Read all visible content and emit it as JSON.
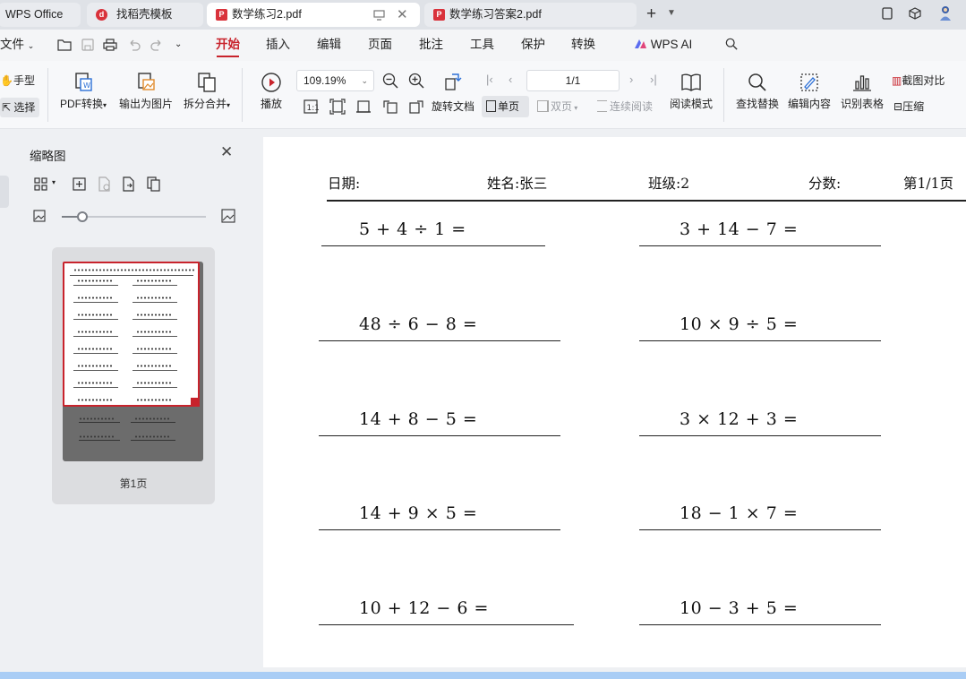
{
  "tabs": [
    {
      "label": "WPS Office",
      "active": false
    },
    {
      "label": "找稻壳模板",
      "active": false
    },
    {
      "label": "数学练习2.pdf",
      "active": true
    },
    {
      "label": "数学练习答案2.pdf",
      "active": false
    }
  ],
  "menu": {
    "file_label": "文件",
    "items": [
      "开始",
      "插入",
      "编辑",
      "页面",
      "批注",
      "工具",
      "保护",
      "转换"
    ],
    "active": "开始",
    "ai_label": "WPS AI"
  },
  "ribbon": {
    "hand_label": "手型",
    "select_label": "选择",
    "pdf_convert": "PDF转换",
    "export_image": "输出为图片",
    "split_merge": "拆分合并",
    "play": "播放",
    "zoom": "109.19%",
    "page_indicator": "1/1",
    "rotate": "旋转文档",
    "single_page": "单页",
    "double_page": "双页",
    "continuous": "连续阅读",
    "read_mode": "阅读模式",
    "find_replace": "查找替换",
    "edit_content": "编辑内容",
    "recognize_table": "识别表格",
    "screenshot_compare": "截图对比",
    "compress": "压缩"
  },
  "thumbnail_panel": {
    "title": "缩略图",
    "zoom_level": 0.14,
    "page_label": "第1页"
  },
  "document": {
    "header": {
      "date_label": "日期:",
      "name_label": "姓名:张三",
      "class_label": "班级:2",
      "score_label": "分数:",
      "page_label": "第1/1页"
    },
    "equations": [
      {
        "left": "5 + 4 ÷ 1 =",
        "right": "3 + 14 − 7 ="
      },
      {
        "left": "48 ÷ 6 − 8 =",
        "right": "10 × 9 ÷ 5 ="
      },
      {
        "left": "14 + 8 − 5 =",
        "right": "3 × 12 + 3 ="
      },
      {
        "left": "14 + 9 × 5 =",
        "right": "18 − 1 × 7 ="
      },
      {
        "left": "10 + 12 − 6 =",
        "right": "10 − 3 + 5 ="
      }
    ]
  },
  "colors": {
    "accent": "#c8232c",
    "status_bar": "#a9cdf5"
  }
}
